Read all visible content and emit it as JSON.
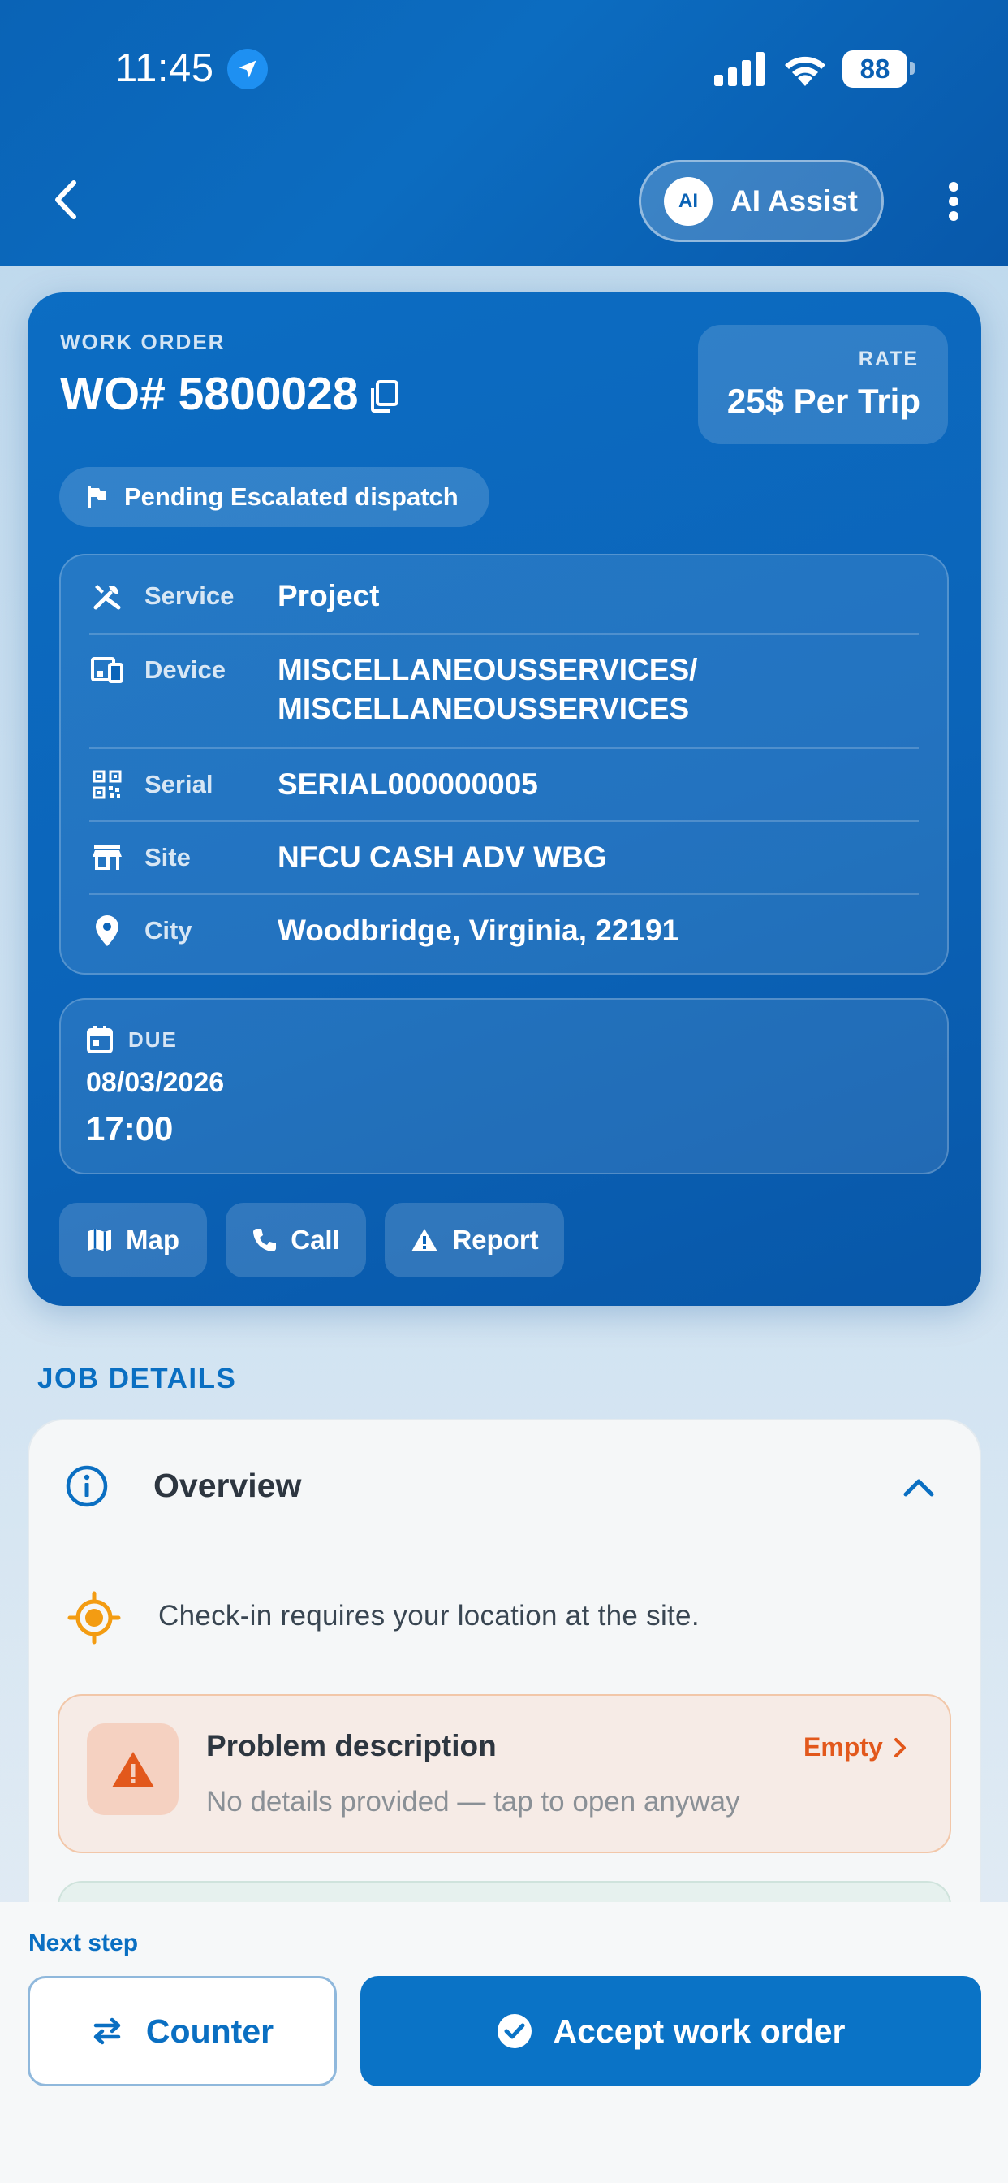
{
  "status_bar": {
    "time": "11:45",
    "battery": "88"
  },
  "header": {
    "ai_badge": "AI",
    "ai_label": "AI Assist"
  },
  "work_order": {
    "kicker": "WORK ORDER",
    "number": "WO# 5800028",
    "rate_kicker": "RATE",
    "rate_value": "25$ Per Trip",
    "status": "Pending Escalated dispatch",
    "details": [
      {
        "label": "Service",
        "value": "Project",
        "icon": "tools-icon"
      },
      {
        "label": "Device",
        "value": "MISCELLANEOUSSERVICES/ MISCELLANEOUSSERVICES",
        "icon": "devices-icon"
      },
      {
        "label": "Serial",
        "value": "SERIAL000000005",
        "icon": "qr-code-icon"
      },
      {
        "label": "Site",
        "value": "NFCU CASH ADV WBG",
        "icon": "store-icon"
      },
      {
        "label": "City",
        "value": "Woodbridge, Virginia, 22191",
        "icon": "location-pin-icon"
      }
    ],
    "due_kicker": "DUE",
    "due_date": "08/03/2026",
    "due_time": "17:00",
    "actions": {
      "map": "Map",
      "call": "Call",
      "report": "Report"
    }
  },
  "job_details": {
    "section_title": "JOB DETAILS",
    "overview_title": "Overview",
    "checkin_text": "Check-in requires your location at the site.",
    "problem_title": "Problem description",
    "problem_status": "Empty",
    "problem_subtitle": "No details provided — tap to open anyway"
  },
  "bottom_bar": {
    "next_label": "Next step",
    "counter_label": "Counter",
    "accept_label": "Accept work order"
  },
  "colors": {
    "primary": "#0a73c6",
    "header_blue": "#0a63b6",
    "warning_orange": "#e2581c",
    "overview_accent": "#f39c12"
  }
}
